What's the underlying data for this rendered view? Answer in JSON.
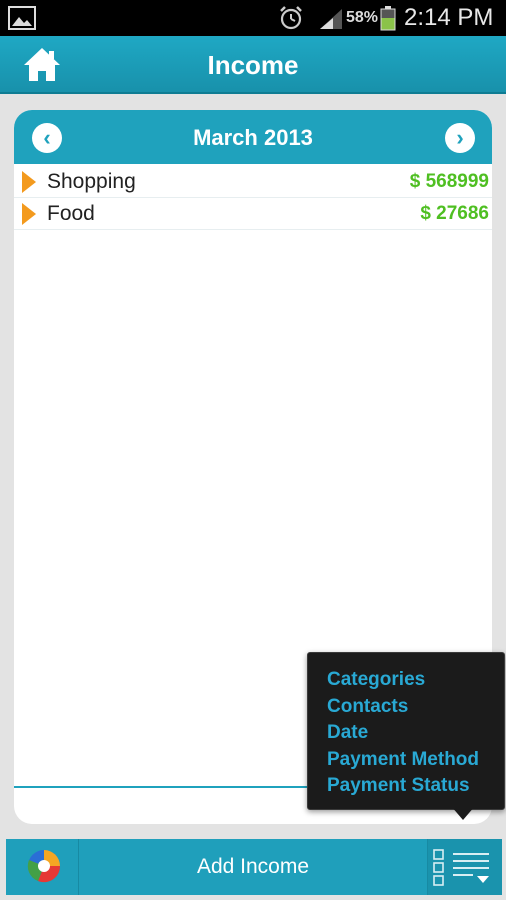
{
  "status_bar": {
    "battery": "58%",
    "time": "2:14 PM"
  },
  "header": {
    "title": "Income",
    "home_icon": "home-icon"
  },
  "month_nav": {
    "title": "March 2013",
    "prev_icon": "chevron-left-icon",
    "next_icon": "chevron-right-icon"
  },
  "entries": [
    {
      "name": "Shopping",
      "amount": "$ 568999"
    },
    {
      "name": "Food",
      "amount": "$ 27686"
    }
  ],
  "popup_menu": {
    "items": [
      "Categories",
      "Contacts",
      "Date",
      "Payment Method",
      "Payment Status"
    ]
  },
  "bottom_bar": {
    "add_label": "Add Income",
    "chart_icon": "pie-chart-icon",
    "menu_icon": "list-menu-icon"
  },
  "colors": {
    "accent": "#1fa2bd",
    "amount": "#4fbf22",
    "marker": "#f39a1e",
    "menu_text": "#29a9d4"
  }
}
